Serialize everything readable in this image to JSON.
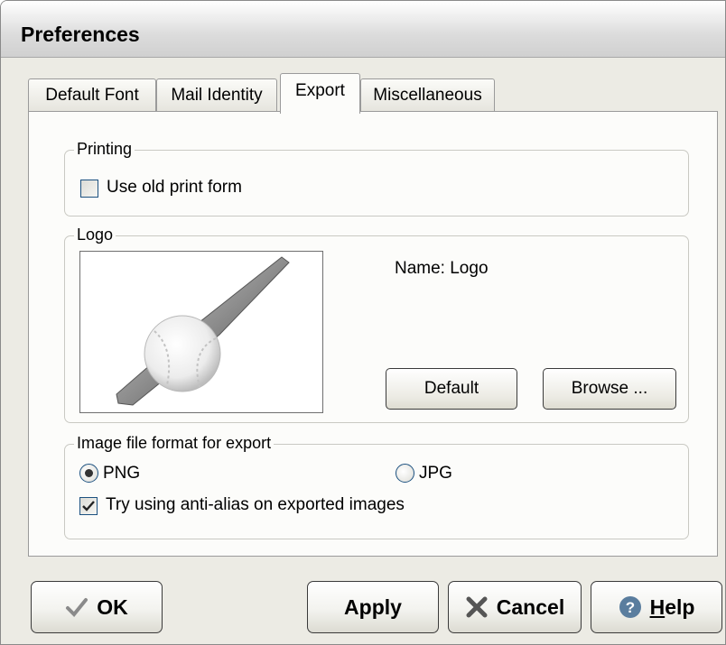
{
  "window": {
    "title": "Preferences"
  },
  "tabs": [
    {
      "label": "Default Font"
    },
    {
      "label": "Mail Identity"
    },
    {
      "label": "Export"
    },
    {
      "label": "Miscellaneous"
    }
  ],
  "printing": {
    "legend": "Printing",
    "old_print_form_label": "Use old print form",
    "old_print_form_checked": false
  },
  "logo": {
    "legend": "Logo",
    "name_text": "Name: Logo",
    "default_label": "Default",
    "browse_label": "Browse ...",
    "image_icon": "baseball-bat-icon"
  },
  "image_format": {
    "legend": "Image file format for export",
    "png_label": "PNG",
    "jpg_label": "JPG",
    "selected": "PNG",
    "antialias_label": "Try using anti-alias on exported images",
    "antialias_checked": true
  },
  "buttons": {
    "ok": "OK",
    "apply": "Apply",
    "cancel": "Cancel",
    "help": "Help"
  },
  "colors": {
    "accent": "#1c5180",
    "help_icon": "#5a7d9e"
  }
}
